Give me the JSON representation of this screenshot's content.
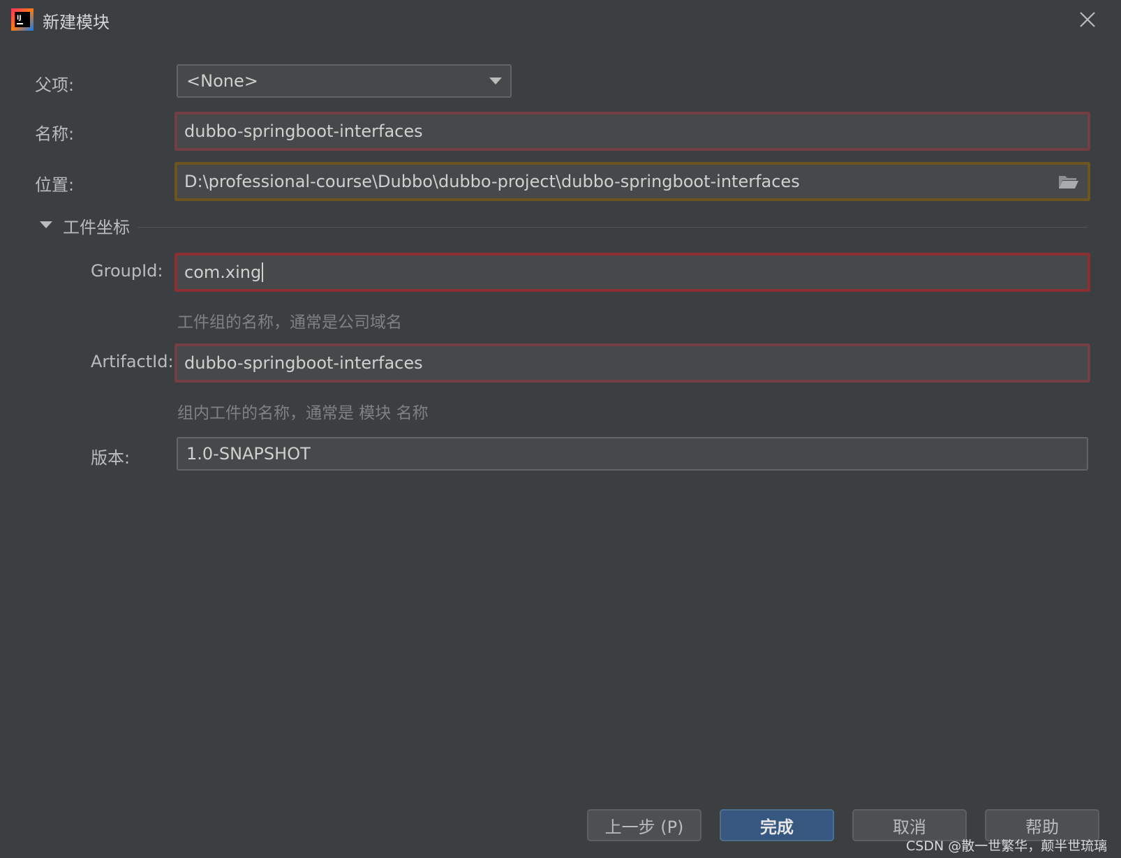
{
  "window": {
    "title": "新建模块"
  },
  "form": {
    "parent_label": "父项:",
    "parent_value": "<None>",
    "name_label": "名称:",
    "name_value": "dubbo-springboot-interfaces",
    "location_label": "位置:",
    "location_value": "D:\\professional-course\\Dubbo\\dubbo-project\\dubbo-springboot-interfaces",
    "section_title": "工件坐标",
    "groupid_label": "GroupId:",
    "groupid_value": "com.xing",
    "groupid_hint": "工件组的名称，通常是公司域名",
    "artifactid_label": "ArtifactId:",
    "artifactid_value": "dubbo-springboot-interfaces",
    "artifactid_hint": "组内工件的名称，通常是 模块 名称",
    "version_label": "版本:",
    "version_value": "1.0-SNAPSHOT"
  },
  "buttons": {
    "previous": "上一步 (P)",
    "finish": "完成",
    "cancel": "取消",
    "help": "帮助"
  },
  "watermark": "CSDN @散一世繁华，颠半世琉璃",
  "colors": {
    "background": "#3c3f41",
    "field_bg": "#45494a",
    "error_border": "#8c2f33",
    "warning_border": "#6d5522",
    "primary_button": "#365880"
  },
  "icons": {
    "app": "intellij-idea-icon",
    "close": "close-icon",
    "dropdown": "chevron-down-icon",
    "folder": "folder-icon",
    "section": "triangle-down-icon"
  }
}
